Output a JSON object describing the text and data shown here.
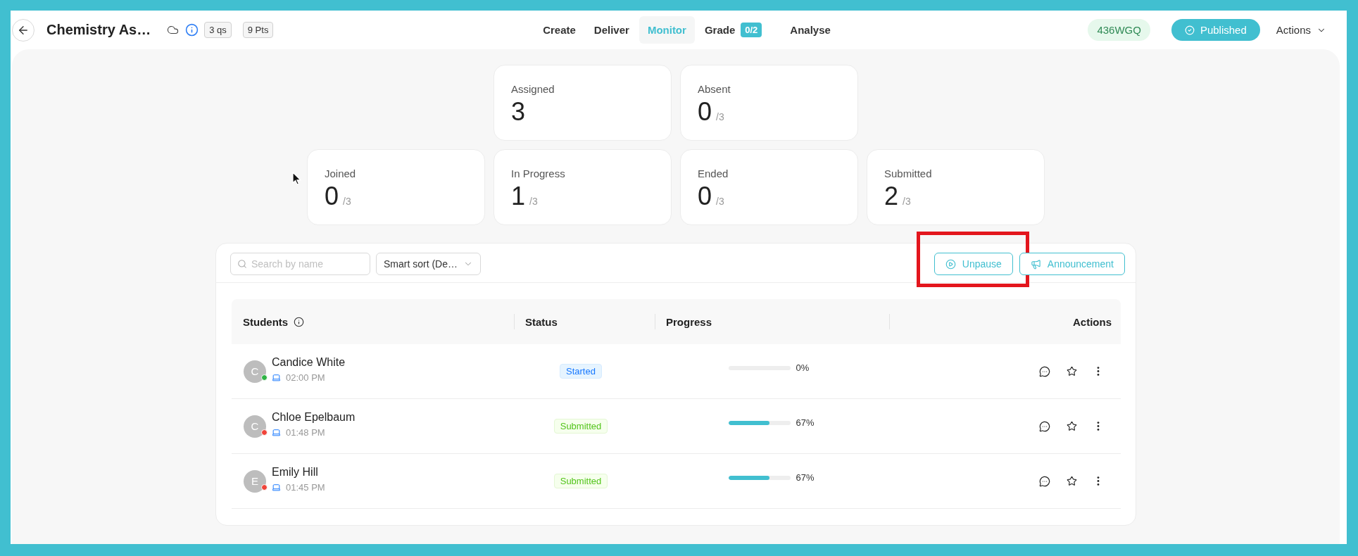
{
  "header": {
    "title": "Chemistry As…",
    "badges": [
      "3 qs",
      "9 Pts"
    ],
    "nav": [
      {
        "label": "Create",
        "selected": false
      },
      {
        "label": "Deliver",
        "selected": false
      },
      {
        "label": "Monitor",
        "selected": true
      },
      {
        "label": "Grade",
        "selected": false,
        "count": "0/2"
      },
      {
        "label": "Analyse",
        "selected": false
      }
    ],
    "code": "436WGQ",
    "status_button": "Published",
    "menu": "Actions"
  },
  "stats": [
    [
      {
        "label": "Assigned",
        "value": "3"
      },
      {
        "label": "Absent",
        "value": "0",
        "total": "/3"
      }
    ],
    [
      {
        "label": "Joined",
        "value": "0",
        "total": "/3"
      },
      {
        "label": "In Progress",
        "value": "1",
        "total": "/3"
      },
      {
        "label": "Ended",
        "value": "0",
        "total": "/3"
      },
      {
        "label": "Submitted",
        "value": "2",
        "total": "/3"
      }
    ]
  ],
  "toolbar": {
    "search": {
      "placeholder": "Search by name"
    },
    "sort": "Smart sort (De…",
    "buttons": [
      {
        "label": "Unpause",
        "kind": "play",
        "highlighted": true
      },
      {
        "label": "Announcement",
        "kind": "megaphone",
        "highlighted": false
      }
    ]
  },
  "table": {
    "columns": [
      {
        "label": "Students",
        "info": true
      },
      {
        "label": "Status",
        "info": false
      },
      {
        "label": "Progress",
        "info": false
      },
      {
        "label": "Actions",
        "info": false
      }
    ],
    "rows": [
      {
        "initial": "C",
        "name": "Candice White",
        "color": "#2fb344",
        "time": "02:00 PM",
        "status": {
          "label": "Started",
          "kind": "started"
        },
        "level": 0,
        "progress": "0%"
      },
      {
        "initial": "C",
        "name": "Chloe Epelbaum",
        "color": "#f0443a",
        "time": "01:48 PM",
        "status": {
          "label": "Submitted",
          "kind": "submitted"
        },
        "level": 0.67,
        "progress": "67%"
      },
      {
        "initial": "E",
        "name": "Emily Hill",
        "color": "#f0443a",
        "time": "01:45 PM",
        "status": {
          "label": "Submitted",
          "kind": "submitted"
        },
        "level": 0.67,
        "progress": "67%"
      }
    ]
  }
}
